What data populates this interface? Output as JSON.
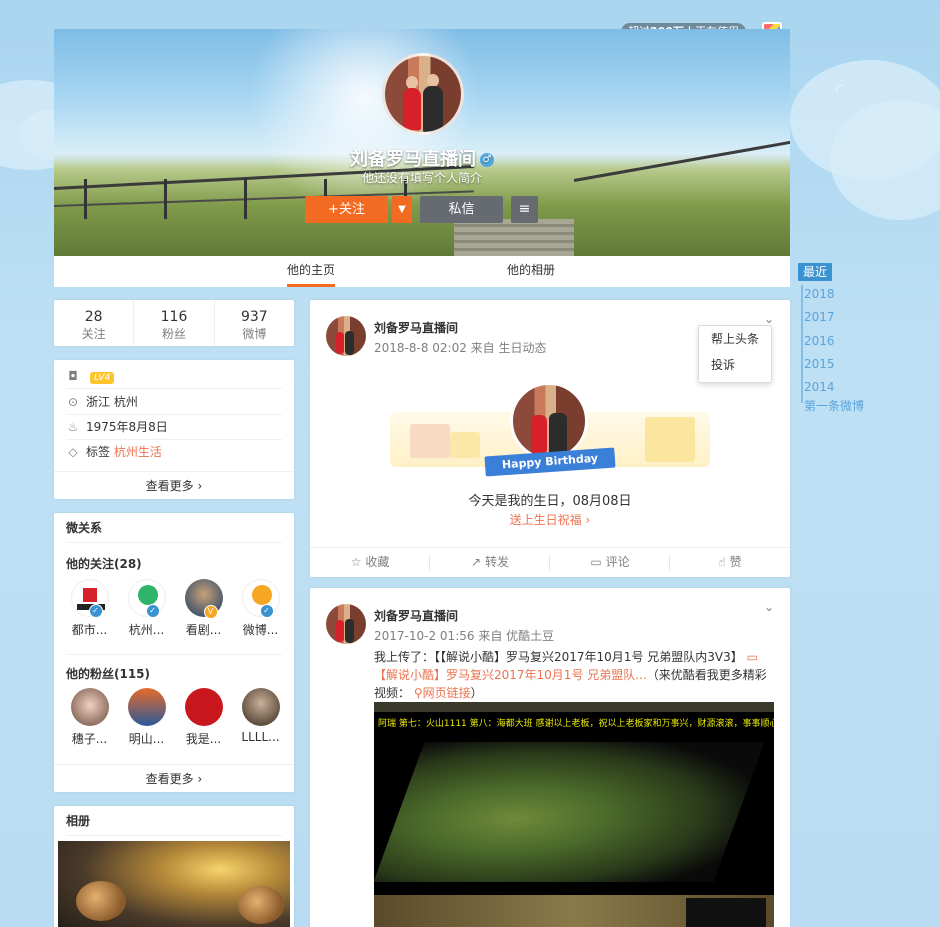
{
  "top": {
    "badge_prefix": "超过",
    "badge_count": "200万",
    "badge_suffix": "人正在使用"
  },
  "profile": {
    "name": "刘备罗马直播间",
    "gender_symbol": "♂",
    "bio": "他还没有填写个人简介",
    "follow_label": "关注",
    "follow_icon": "+",
    "message_label": "私信",
    "more_icon": "≡"
  },
  "tabs": [
    {
      "label": "他的主页",
      "active": true
    },
    {
      "label": "他的相册",
      "active": false
    }
  ],
  "stats": [
    {
      "num": "28",
      "label": "关注"
    },
    {
      "num": "116",
      "label": "粉丝"
    },
    {
      "num": "937",
      "label": "微博"
    }
  ],
  "info": {
    "level": "LV4",
    "location": "浙江 杭州",
    "birthday": "1975年8月8日",
    "tags_label": "标签",
    "tags_value": "杭州生活",
    "more": "查看更多"
  },
  "relations": {
    "title": "微关系",
    "following_title": "他的关注(28)",
    "following": [
      {
        "name": "都市..."
      },
      {
        "name": "杭州..."
      },
      {
        "name": "看剧..."
      },
      {
        "name": "微博..."
      }
    ],
    "fans_title": "他的粉丝(115)",
    "fans": [
      {
        "name": "穗子..."
      },
      {
        "name": "明山..."
      },
      {
        "name": "我是..."
      },
      {
        "name": "LLLL..."
      }
    ],
    "more": "查看更多"
  },
  "album": {
    "title": "相册"
  },
  "posts": [
    {
      "author": "刘备罗马直播间",
      "time": "2018-8-8 02:02 来自 生日动态",
      "menu": [
        "帮上头条",
        "投诉"
      ],
      "ribbon": "Happy Birthday",
      "birthday_text": "今天是我的生日，08月08日",
      "birthday_link": "送上生日祝福"
    },
    {
      "author": "刘备罗马直播间",
      "time": "2017-10-2 01:56 来自 优酷土豆",
      "text1": "我上传了：【【解说小酷】罗马复兴2017年10月1号 兄弟盟队内3V3】",
      "link1": "【解说小酷】罗马复兴2017年10月1号 兄弟盟队...",
      "text2": "（来优酷看我更多精彩视频：",
      "link2": "网页链接",
      "text3": "）",
      "video_ticker": "阿瑞 第七：火山1111 第八：海都大班    感谢以上老板，祝以上老板家和万事兴，财源滚滚，事事顺心"
    }
  ],
  "actions": [
    "收藏",
    "转发",
    "评论",
    "赞"
  ],
  "timeline": {
    "items": [
      "最近",
      "2018",
      "2017",
      "2016",
      "2015",
      "2014"
    ],
    "first": "第一条微博"
  }
}
